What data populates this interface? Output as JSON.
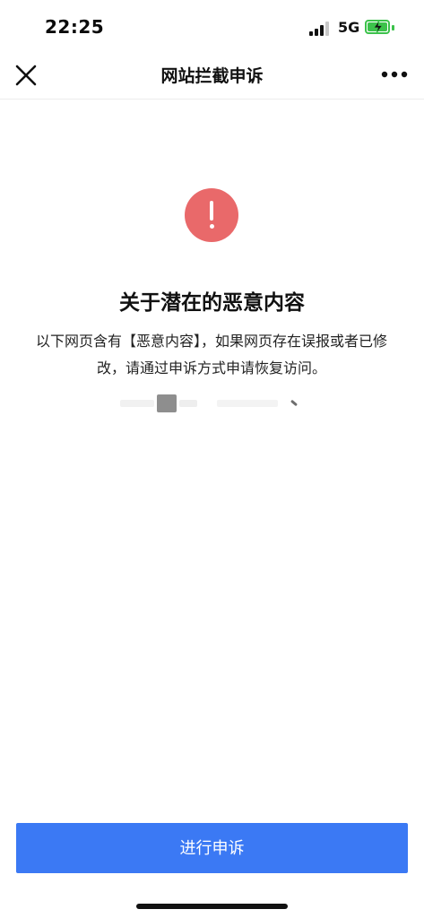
{
  "status_bar": {
    "time": "22:25",
    "network": "5G"
  },
  "nav": {
    "title": "网站拦截申诉",
    "close_icon": "close-icon",
    "more_icon": "more-horizontal-icon"
  },
  "content": {
    "icon": "exclamation-circle-icon",
    "icon_color": "#e9696a",
    "heading": "关于潜在的恶意内容",
    "description": "以下网页含有【恶意内容】，如果网页存在误报或者已修改，请通过申诉方式申请恢复访问。"
  },
  "footer": {
    "button_label": "进行申诉",
    "button_color": "#3b79f4"
  }
}
